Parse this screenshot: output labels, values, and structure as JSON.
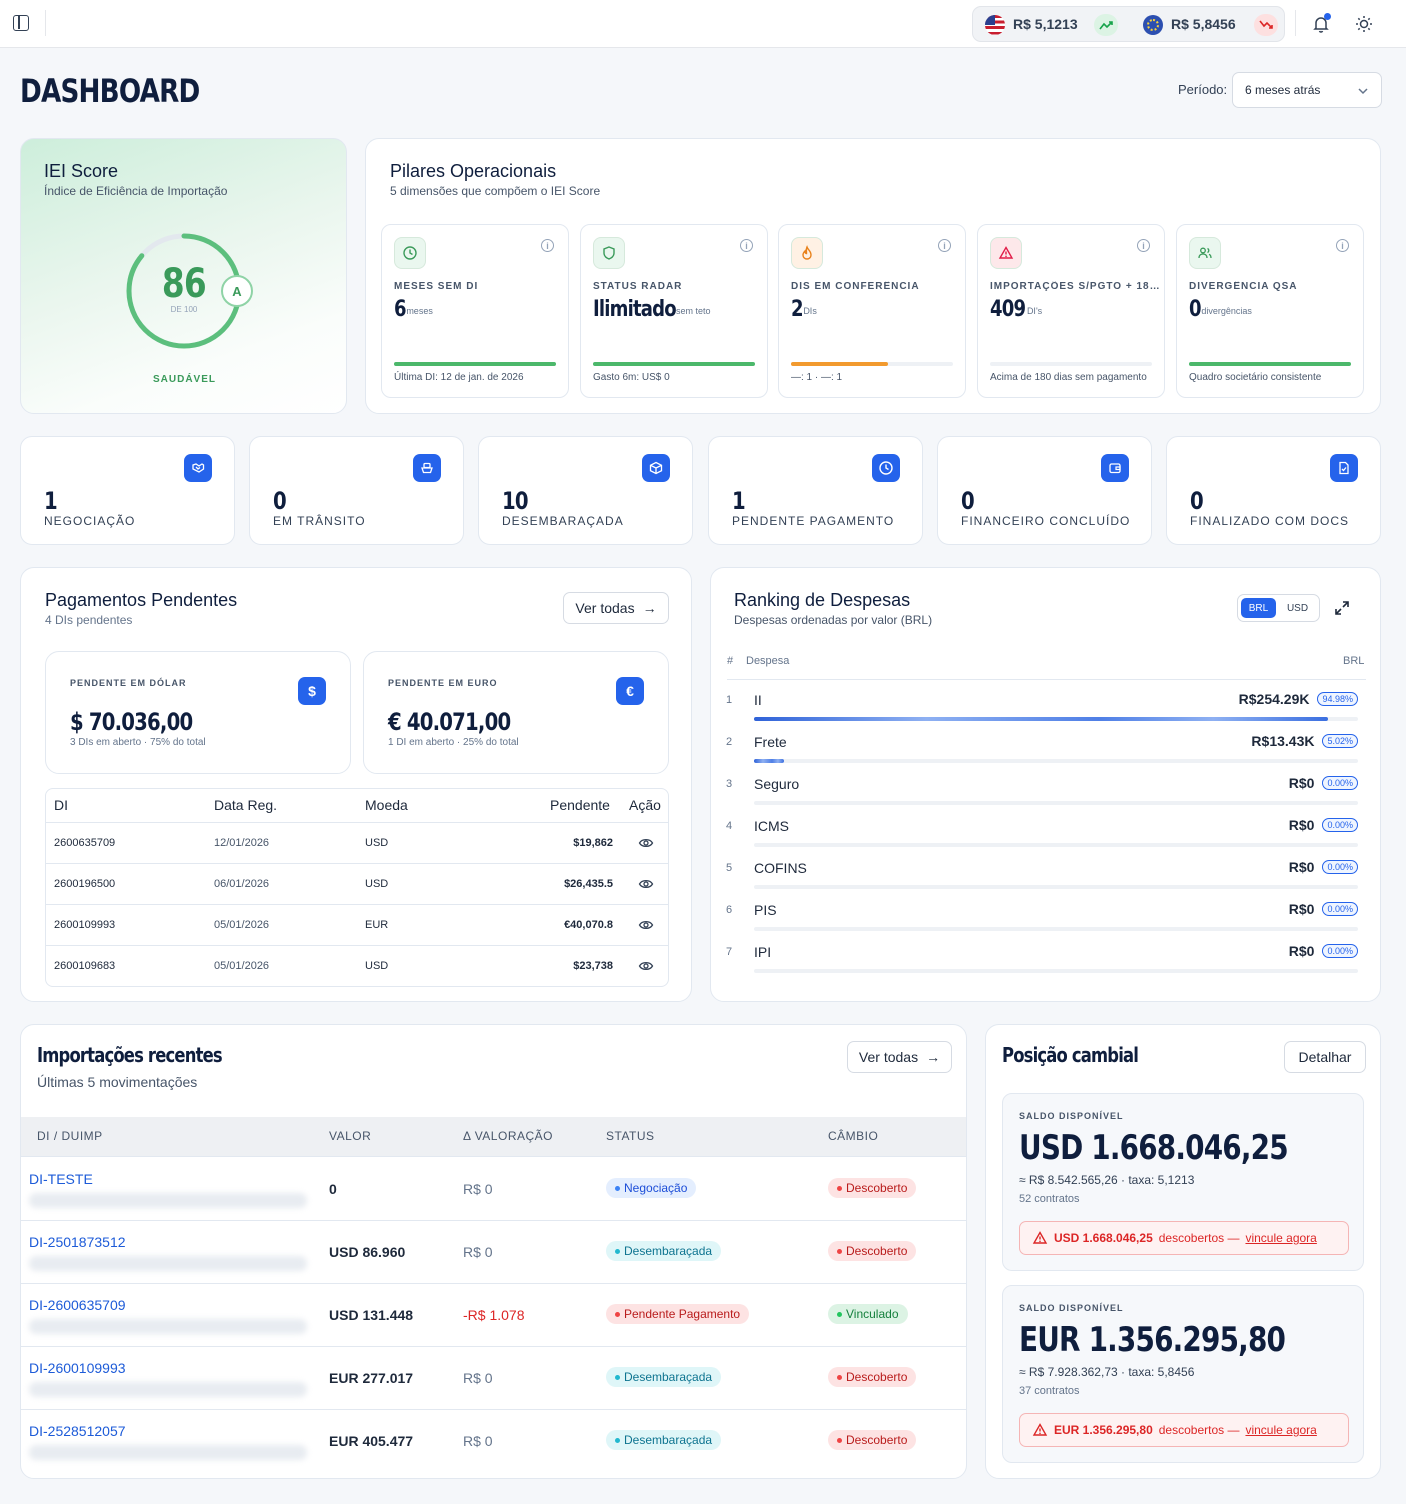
{
  "topbar": {
    "usd_rate": "R$ 5,1213",
    "eur_rate": "R$ 5,8456"
  },
  "header": {
    "title": "DASHBOARD",
    "period_label": "Período:",
    "period_value": "6 meses atrás"
  },
  "iei": {
    "title": "IEI Score",
    "subtitle": "Índice de Eficiência de Importação",
    "score": "86",
    "score_max": "DE 100",
    "grade": "A",
    "status": "SAUDÁVEL",
    "score_fraction": 0.86
  },
  "pillars": {
    "title": "Pilares Operacionais",
    "subtitle": "5 dimensões que compõem o IEI Score",
    "items": [
      {
        "label": "MESES SEM DI",
        "value": "6",
        "unit": "meses",
        "footer": "Última DI: 12 de jan. de 2026",
        "progress": 1.0,
        "color": "#4cb86b",
        "icon": "clock-icon"
      },
      {
        "label": "STATUS RADAR",
        "value": "Ilimitado",
        "unit": "sem teto",
        "footer": "Gasto 6m: US$ 0",
        "progress": 1.0,
        "color": "#4cb86b",
        "icon": "shield-icon"
      },
      {
        "label": "DIS EM CONFERÊNCIA",
        "value": "2",
        "unit": "DIs",
        "footer": "—: 1 · —: 1",
        "progress": 0.6,
        "color": "#f29a2e",
        "icon": "flame-icon"
      },
      {
        "label": "IMPORTAÇÕES S/PGTO + 18…",
        "value": "409",
        "unit": "DI's",
        "footer": "Acima de 180 dias sem pagamento",
        "progress": 0,
        "color": "#e11d48",
        "icon": "alert-icon"
      },
      {
        "label": "DIVERGÊNCIA QSA",
        "value": "0",
        "unit": "divergências",
        "footer": "Quadro societário consistente",
        "progress": 1.0,
        "color": "#4cb86b",
        "icon": "users-icon"
      }
    ]
  },
  "stats": [
    {
      "value": "1",
      "label": "NEGOCIAÇÃO",
      "icon": "handshake-icon"
    },
    {
      "value": "0",
      "label": "EM TRÂNSITO",
      "icon": "ship-icon"
    },
    {
      "value": "10",
      "label": "DESEMBARAÇADA",
      "icon": "package-icon"
    },
    {
      "value": "1",
      "label": "PENDENTE PAGAMENTO",
      "icon": "clock-icon"
    },
    {
      "value": "0",
      "label": "FINANCEIRO CONCLUÍDO",
      "icon": "wallet-icon"
    },
    {
      "value": "0",
      "label": "FINALIZADO COM DOCS",
      "icon": "file-check-icon"
    }
  ],
  "payments": {
    "title": "Pagamentos Pendentes",
    "subtitle": "4 DIs pendentes",
    "view_all": "Ver todas",
    "usd": {
      "label": "PENDENTE EM DÓLAR",
      "value": "$ 70.036,00",
      "note": "3 DIs em aberto · 75% do total"
    },
    "eur": {
      "label": "PENDENTE EM EURO",
      "value": "€ 40.071,00",
      "note": "1 DI em aberto · 25% do total"
    },
    "columns": [
      "DI",
      "Data Reg.",
      "Moeda",
      "Pendente",
      "Ação"
    ],
    "rows": [
      {
        "di": "2600635709",
        "date": "12/01/2026",
        "currency": "USD",
        "pending": "$19,862"
      },
      {
        "di": "2600196500",
        "date": "06/01/2026",
        "currency": "USD",
        "pending": "$26,435.5"
      },
      {
        "di": "2600109993",
        "date": "05/01/2026",
        "currency": "EUR",
        "pending": "€40,070.8"
      },
      {
        "di": "2600109683",
        "date": "05/01/2026",
        "currency": "USD",
        "pending": "$23,738"
      }
    ]
  },
  "ranking": {
    "title": "Ranking de Despesas",
    "subtitle": "Despesas ordenadas por valor (BRL)",
    "toggle_brl": "BRL",
    "toggle_usd": "USD",
    "col_hash": "#",
    "col_name": "Despesa",
    "col_currency": "BRL",
    "items": [
      {
        "rank": "1",
        "name": "II",
        "value": "R$254.29K",
        "pct": "94.98%",
        "share": 0.9498
      },
      {
        "rank": "2",
        "name": "Frete",
        "value": "R$13.43K",
        "pct": "5.02%",
        "share": 0.0502
      },
      {
        "rank": "3",
        "name": "Seguro",
        "value": "R$0",
        "pct": "0.00%",
        "share": 0
      },
      {
        "rank": "4",
        "name": "ICMS",
        "value": "R$0",
        "pct": "0.00%",
        "share": 0
      },
      {
        "rank": "5",
        "name": "COFINS",
        "value": "R$0",
        "pct": "0.00%",
        "share": 0
      },
      {
        "rank": "6",
        "name": "PIS",
        "value": "R$0",
        "pct": "0.00%",
        "share": 0
      },
      {
        "rank": "7",
        "name": "IPI",
        "value": "R$0",
        "pct": "0.00%",
        "share": 0
      }
    ]
  },
  "recent": {
    "title": "Importações recentes",
    "subtitle": "Últimas 5 movimentações",
    "view_all": "Ver todas",
    "columns": [
      "DI / DUIMP",
      "VALOR",
      "Δ VALORAÇÃO",
      "STATUS",
      "CÂMBIO"
    ],
    "rows": [
      {
        "di": "DI-TESTE",
        "value": "0",
        "delta": "R$ 0",
        "status": "Negociação",
        "status_kind": "blue",
        "fx": "Descoberto",
        "fx_kind": "red"
      },
      {
        "di": "DI-2501873512",
        "value": "USD 86.960",
        "delta": "R$ 0",
        "status": "Desembaraçada",
        "status_kind": "cyan",
        "fx": "Descoberto",
        "fx_kind": "red"
      },
      {
        "di": "DI-2600635709",
        "value": "USD 131.448",
        "delta": "-R$ 1.078",
        "status": "Pendente Pagamento",
        "status_kind": "red",
        "fx": "Vinculado",
        "fx_kind": "green"
      },
      {
        "di": "DI-2600109993",
        "value": "EUR 277.017",
        "delta": "R$ 0",
        "status": "Desembaraçada",
        "status_kind": "cyan",
        "fx": "Descoberto",
        "fx_kind": "red"
      },
      {
        "di": "DI-2528512057",
        "value": "EUR 405.477",
        "delta": "R$ 0",
        "status": "Desembaraçada",
        "status_kind": "cyan",
        "fx": "Descoberto",
        "fx_kind": "red"
      }
    ]
  },
  "fx_position": {
    "title": "Posição cambial",
    "detail": "Detalhar",
    "blocks": [
      {
        "label": "SALDO DISPONÍVEL",
        "value": "USD 1.668.046,25",
        "brl": "≈ R$ 8.542.565,26 · taxa: 5,1213",
        "contracts": "52 contratos",
        "alert_amount": "USD 1.668.046,25",
        "alert_text": "descobertos —",
        "alert_link": "vincule agora"
      },
      {
        "label": "SALDO DISPONÍVEL",
        "value": "EUR 1.356.295,80",
        "brl": "≈ R$ 7.928.362,73 · taxa: 5,8456",
        "contracts": "37 contratos",
        "alert_amount": "EUR 1.356.295,80",
        "alert_text": "descobertos —",
        "alert_link": "vincule agora"
      }
    ]
  }
}
